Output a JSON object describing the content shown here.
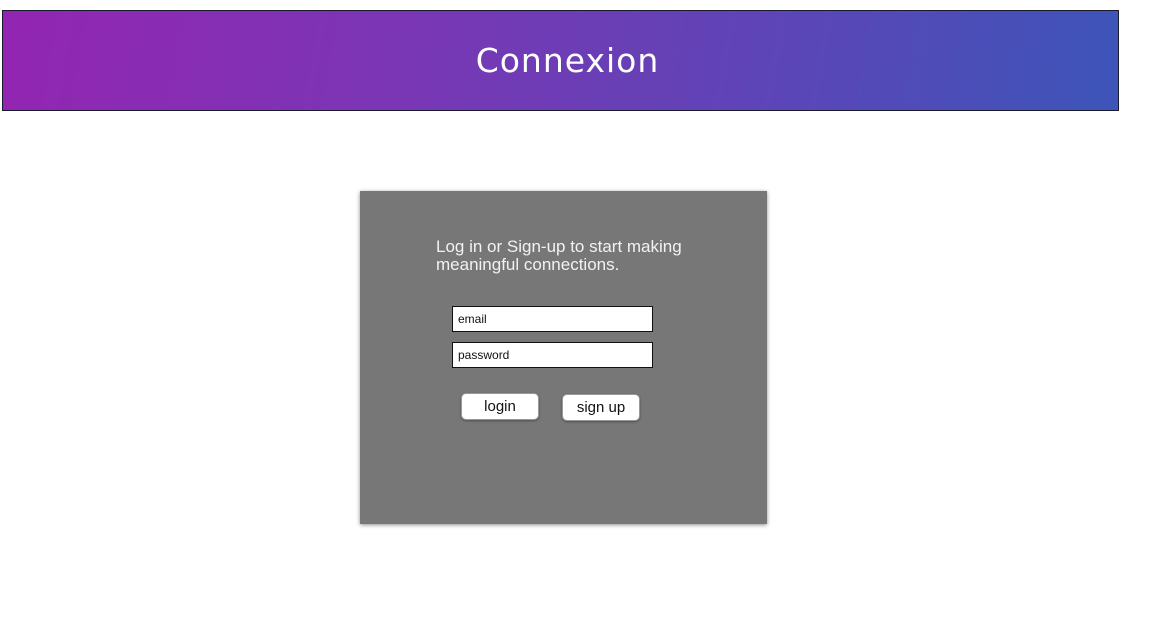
{
  "header": {
    "title": "Connexion",
    "gradient_start": "#9325b2",
    "gradient_end": "#3d55b8"
  },
  "card": {
    "tagline": "Log in or Sign-up to start making meaningful connections.",
    "background": "#777777"
  },
  "form": {
    "email_placeholder": "email",
    "password_placeholder": "password",
    "login_label": "login",
    "signup_label": "sign up"
  }
}
